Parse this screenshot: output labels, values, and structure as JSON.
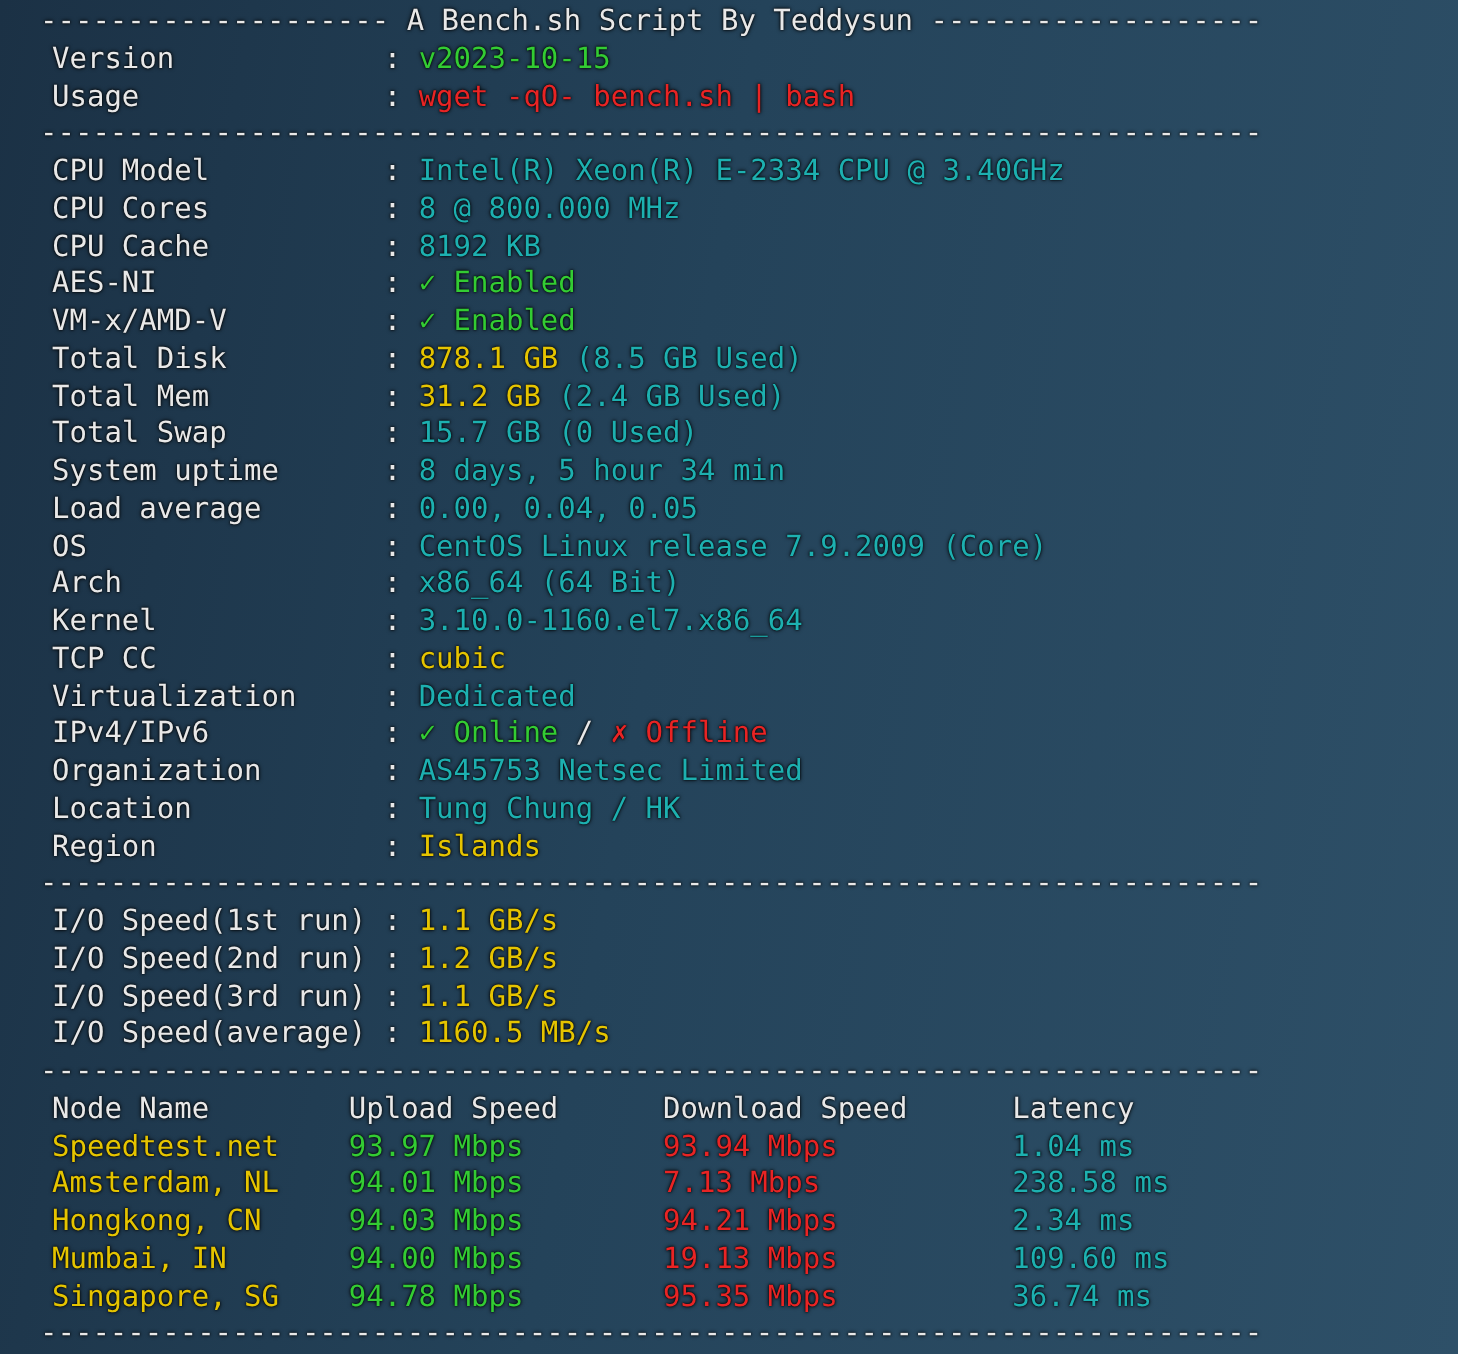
{
  "lines": [
    {
      "kind": "title",
      "left": "--------------------",
      "title": "A Bench.sh Script By Teddysun",
      "right": "-------------------"
    },
    {
      "kind": "field",
      "label": "Version",
      "sep": ":",
      "parts": [
        {
          "text": "v2023-10-15",
          "color": "#33cc33"
        }
      ]
    },
    {
      "kind": "field",
      "label": "Usage",
      "sep": ":",
      "parts": [
        {
          "text": "wget -qO- bench.sh | bash",
          "color": "#e82424"
        }
      ]
    },
    {
      "kind": "rule",
      "text": "----------------------------------------------------------------------"
    },
    {
      "kind": "field",
      "label": "CPU Model",
      "sep": ":",
      "parts": [
        {
          "text": "Intel(R) Xeon(R) E-2334 CPU @ 3.40GHz",
          "color": "#1db0b0"
        }
      ]
    },
    {
      "kind": "field",
      "label": "CPU Cores",
      "sep": ":",
      "parts": [
        {
          "text": "8 @ 800.000 MHz",
          "color": "#1db0b0"
        }
      ]
    },
    {
      "kind": "field",
      "label": "CPU Cache",
      "sep": ":",
      "parts": [
        {
          "text": "8192 KB",
          "color": "#1db0b0"
        }
      ]
    },
    {
      "kind": "field",
      "label": "AES-NI",
      "sep": ":",
      "parts": [
        {
          "text": "✓ Enabled",
          "color": "#33cc33"
        }
      ]
    },
    {
      "kind": "field",
      "label": "VM-x/AMD-V",
      "sep": ":",
      "parts": [
        {
          "text": "✓ Enabled",
          "color": "#33cc33"
        }
      ]
    },
    {
      "kind": "field",
      "label": "Total Disk",
      "sep": ":",
      "parts": [
        {
          "text": "878.1 GB",
          "color": "#e5c400"
        },
        {
          "text": "(8.5 GB Used)",
          "color": "#1db0b0"
        }
      ]
    },
    {
      "kind": "field",
      "label": "Total Mem",
      "sep": ":",
      "parts": [
        {
          "text": "31.2 GB",
          "color": "#e5c400"
        },
        {
          "text": "(2.4 GB Used)",
          "color": "#1db0b0"
        }
      ]
    },
    {
      "kind": "field",
      "label": "Total Swap",
      "sep": ":",
      "parts": [
        {
          "text": "15.7 GB (0 Used)",
          "color": "#1db0b0"
        }
      ]
    },
    {
      "kind": "field",
      "label": "System uptime",
      "sep": ":",
      "parts": [
        {
          "text": "8 days, 5 hour 34 min",
          "color": "#1db0b0"
        }
      ]
    },
    {
      "kind": "field",
      "label": "Load average",
      "sep": ":",
      "parts": [
        {
          "text": "0.00, 0.04, 0.05",
          "color": "#1db0b0"
        }
      ]
    },
    {
      "kind": "field",
      "label": "OS",
      "sep": ":",
      "parts": [
        {
          "text": "CentOS Linux release 7.9.2009 (Core)",
          "color": "#1db0b0"
        }
      ]
    },
    {
      "kind": "field",
      "label": "Arch",
      "sep": ":",
      "parts": [
        {
          "text": "x86_64 (64 Bit)",
          "color": "#1db0b0"
        }
      ]
    },
    {
      "kind": "field",
      "label": "Kernel",
      "sep": ":",
      "parts": [
        {
          "text": "3.10.0-1160.el7.x86_64",
          "color": "#1db0b0"
        }
      ]
    },
    {
      "kind": "field",
      "label": "TCP CC",
      "sep": ":",
      "parts": [
        {
          "text": "cubic",
          "color": "#e5c400"
        }
      ]
    },
    {
      "kind": "field",
      "label": "Virtualization",
      "sep": ":",
      "parts": [
        {
          "text": "Dedicated",
          "color": "#1db0b0"
        }
      ]
    },
    {
      "kind": "field",
      "label": "IPv4/IPv6",
      "sep": ":",
      "parts": [
        {
          "text": "✓ Online",
          "color": "#33cc33"
        },
        {
          "text": "/",
          "color": "#e8e8e8"
        },
        {
          "text": "✗ Offline",
          "color": "#e82424"
        }
      ]
    },
    {
      "kind": "field",
      "label": "Organization",
      "sep": ":",
      "parts": [
        {
          "text": "AS45753 Netsec Limited",
          "color": "#1db0b0"
        }
      ]
    },
    {
      "kind": "field",
      "label": "Location",
      "sep": ":",
      "parts": [
        {
          "text": "Tung Chung / HK",
          "color": "#1db0b0"
        }
      ]
    },
    {
      "kind": "field",
      "label": "Region",
      "sep": ":",
      "parts": [
        {
          "text": "Islands",
          "color": "#e5c400"
        }
      ]
    },
    {
      "kind": "rule",
      "text": "----------------------------------------------------------------------"
    },
    {
      "kind": "field",
      "label": "I/O Speed(1st run)",
      "sep": ":",
      "parts": [
        {
          "text": "1.1 GB/s",
          "color": "#e5c400"
        }
      ]
    },
    {
      "kind": "field",
      "label": "I/O Speed(2nd run)",
      "sep": ":",
      "parts": [
        {
          "text": "1.2 GB/s",
          "color": "#e5c400"
        }
      ]
    },
    {
      "kind": "field",
      "label": "I/O Speed(3rd run)",
      "sep": ":",
      "parts": [
        {
          "text": "1.1 GB/s",
          "color": "#e5c400"
        }
      ]
    },
    {
      "kind": "field",
      "label": "I/O Speed(average)",
      "sep": ":",
      "parts": [
        {
          "text": "1160.5 MB/s",
          "color": "#e5c400"
        }
      ]
    },
    {
      "kind": "rule",
      "text": "----------------------------------------------------------------------"
    },
    {
      "kind": "table_row",
      "cells": [
        {
          "text": "Node Name",
          "color": "#e8e8e8"
        },
        {
          "text": "Upload Speed",
          "color": "#e8e8e8"
        },
        {
          "text": "Download Speed",
          "color": "#e8e8e8"
        },
        {
          "text": "Latency",
          "color": "#e8e8e8"
        }
      ]
    },
    {
      "kind": "table_row",
      "cells": [
        {
          "text": "Speedtest.net",
          "color": "#e5c400"
        },
        {
          "text": "93.97 Mbps",
          "color": "#33cc33"
        },
        {
          "text": "93.94 Mbps",
          "color": "#e82424"
        },
        {
          "text": "1.04 ms",
          "color": "#1db0b0"
        }
      ]
    },
    {
      "kind": "table_row",
      "cells": [
        {
          "text": "Amsterdam, NL",
          "color": "#e5c400"
        },
        {
          "text": "94.01 Mbps",
          "color": "#33cc33"
        },
        {
          "text": "7.13 Mbps",
          "color": "#e82424"
        },
        {
          "text": "238.58 ms",
          "color": "#1db0b0"
        }
      ]
    },
    {
      "kind": "table_row",
      "cells": [
        {
          "text": "Hongkong, CN",
          "color": "#e5c400"
        },
        {
          "text": "94.03 Mbps",
          "color": "#33cc33"
        },
        {
          "text": "94.21 Mbps",
          "color": "#e82424"
        },
        {
          "text": "2.34 ms",
          "color": "#1db0b0"
        }
      ]
    },
    {
      "kind": "table_row",
      "cells": [
        {
          "text": "Mumbai, IN",
          "color": "#e5c400"
        },
        {
          "text": "94.00 Mbps",
          "color": "#33cc33"
        },
        {
          "text": "19.13 Mbps",
          "color": "#e82424"
        },
        {
          "text": "109.60 ms",
          "color": "#1db0b0"
        }
      ]
    },
    {
      "kind": "table_row",
      "cells": [
        {
          "text": "Singapore, SG",
          "color": "#e5c400"
        },
        {
          "text": "94.78 Mbps",
          "color": "#33cc33"
        },
        {
          "text": "95.35 Mbps",
          "color": "#e82424"
        },
        {
          "text": "36.74 ms",
          "color": "#1db0b0"
        }
      ]
    },
    {
      "kind": "rule",
      "text": "----------------------------------------------------------------------"
    }
  ]
}
